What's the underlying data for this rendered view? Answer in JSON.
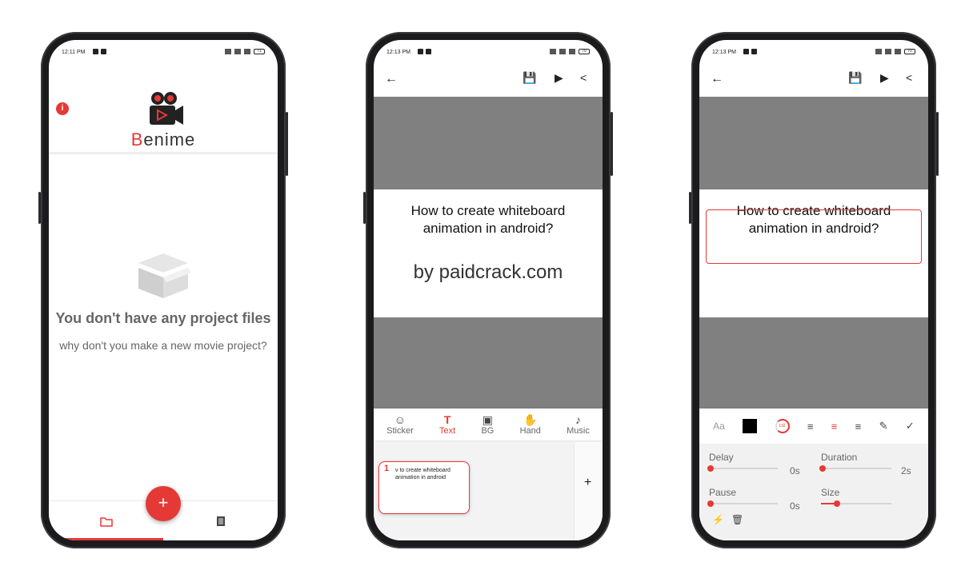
{
  "colors": {
    "accent": "#e53935",
    "canvas_gray": "#808080"
  },
  "phone1": {
    "status_time": "12:11 PM",
    "battery": "71",
    "app_name_first": "B",
    "app_name_rest": "enime",
    "empty_title": "You don't have any project files",
    "empty_subtitle": "why don't you make a new movie project?",
    "fab_label": "+",
    "nav_items": [
      "folder-icon",
      "film-icon"
    ]
  },
  "phone2": {
    "status_time": "12:13 PM",
    "battery": "70",
    "slide_title_line1": "How to create whiteboard",
    "slide_title_line2": "animation in android?",
    "slide_credit": "by paidcrack.com",
    "tools": [
      {
        "icon": "☺",
        "label": "Sticker"
      },
      {
        "icon": "T",
        "label": "Text"
      },
      {
        "icon": "▣",
        "label": "BG"
      },
      {
        "icon": "✋",
        "label": "Hand"
      },
      {
        "icon": "♪",
        "label": "Music"
      }
    ],
    "active_tool": "Text",
    "scene_number": "1",
    "scene_thumb_text": "v to create whiteboard animation in android",
    "add_scene": "+"
  },
  "phone3": {
    "status_time": "12:13 PM",
    "battery": "70",
    "slide_title_line1": "How to create whiteboard",
    "slide_title_line2": "animation in android?",
    "font_label": "Aa",
    "rotation_value": "132",
    "props": {
      "delay_label": "Delay",
      "delay_value": "0s",
      "delay_level": 0,
      "duration_label": "Duration",
      "duration_value": "2s",
      "duration_level": 0,
      "pause_label": "Pause",
      "pause_value": "0s",
      "pause_level": 0,
      "size_label": "Size",
      "size_level": 0.2
    }
  }
}
